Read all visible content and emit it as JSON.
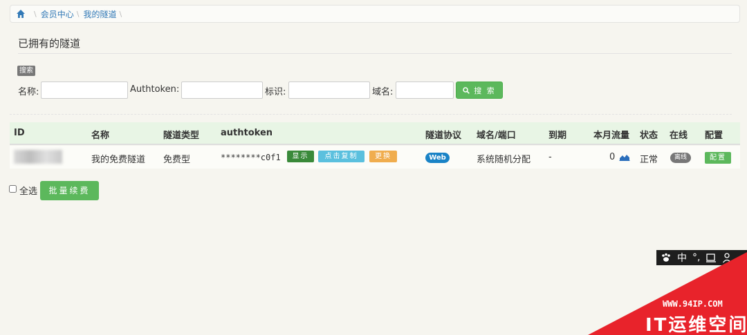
{
  "breadcrumb": {
    "items": [
      "会员中心",
      "我的隧道"
    ]
  },
  "page": {
    "title": "已拥有的隧道"
  },
  "search": {
    "badge": "搜索",
    "name_label": "名称:",
    "token_label": "Authtoken:",
    "tag_label": "标识:",
    "domain_label": "域名:",
    "button_label": "搜 索",
    "name_value": "",
    "token_value": "",
    "tag_value": "",
    "domain_value": ""
  },
  "table": {
    "headers": [
      "ID",
      "名称",
      "隧道类型",
      "authtoken",
      "隧道协议",
      "域名/端口",
      "到期",
      "本月流量",
      "状态",
      "在线",
      "配置"
    ],
    "rows": [
      {
        "name": "我的免费隧道",
        "type": "免费型",
        "token": "********c0f1",
        "show": "显示",
        "copy": "点击复制",
        "change": "更换",
        "protocol": "Web",
        "domain": "系统随机分配",
        "expire": "-",
        "traffic": "0",
        "status": "正常",
        "online": "离线",
        "config": "配置"
      }
    ]
  },
  "bulk": {
    "select_all": "全选",
    "renew": "批量续费"
  },
  "ime": {
    "mode": "中",
    "punct": "°,"
  },
  "watermark": {
    "url": "WWW.94IP.COM",
    "name": "IT运维空间"
  },
  "colors": {
    "primary_green": "#5cb85c",
    "badge_blue": "#1a83c6",
    "link": "#337ab7",
    "watermark_red": "#e8232b"
  }
}
